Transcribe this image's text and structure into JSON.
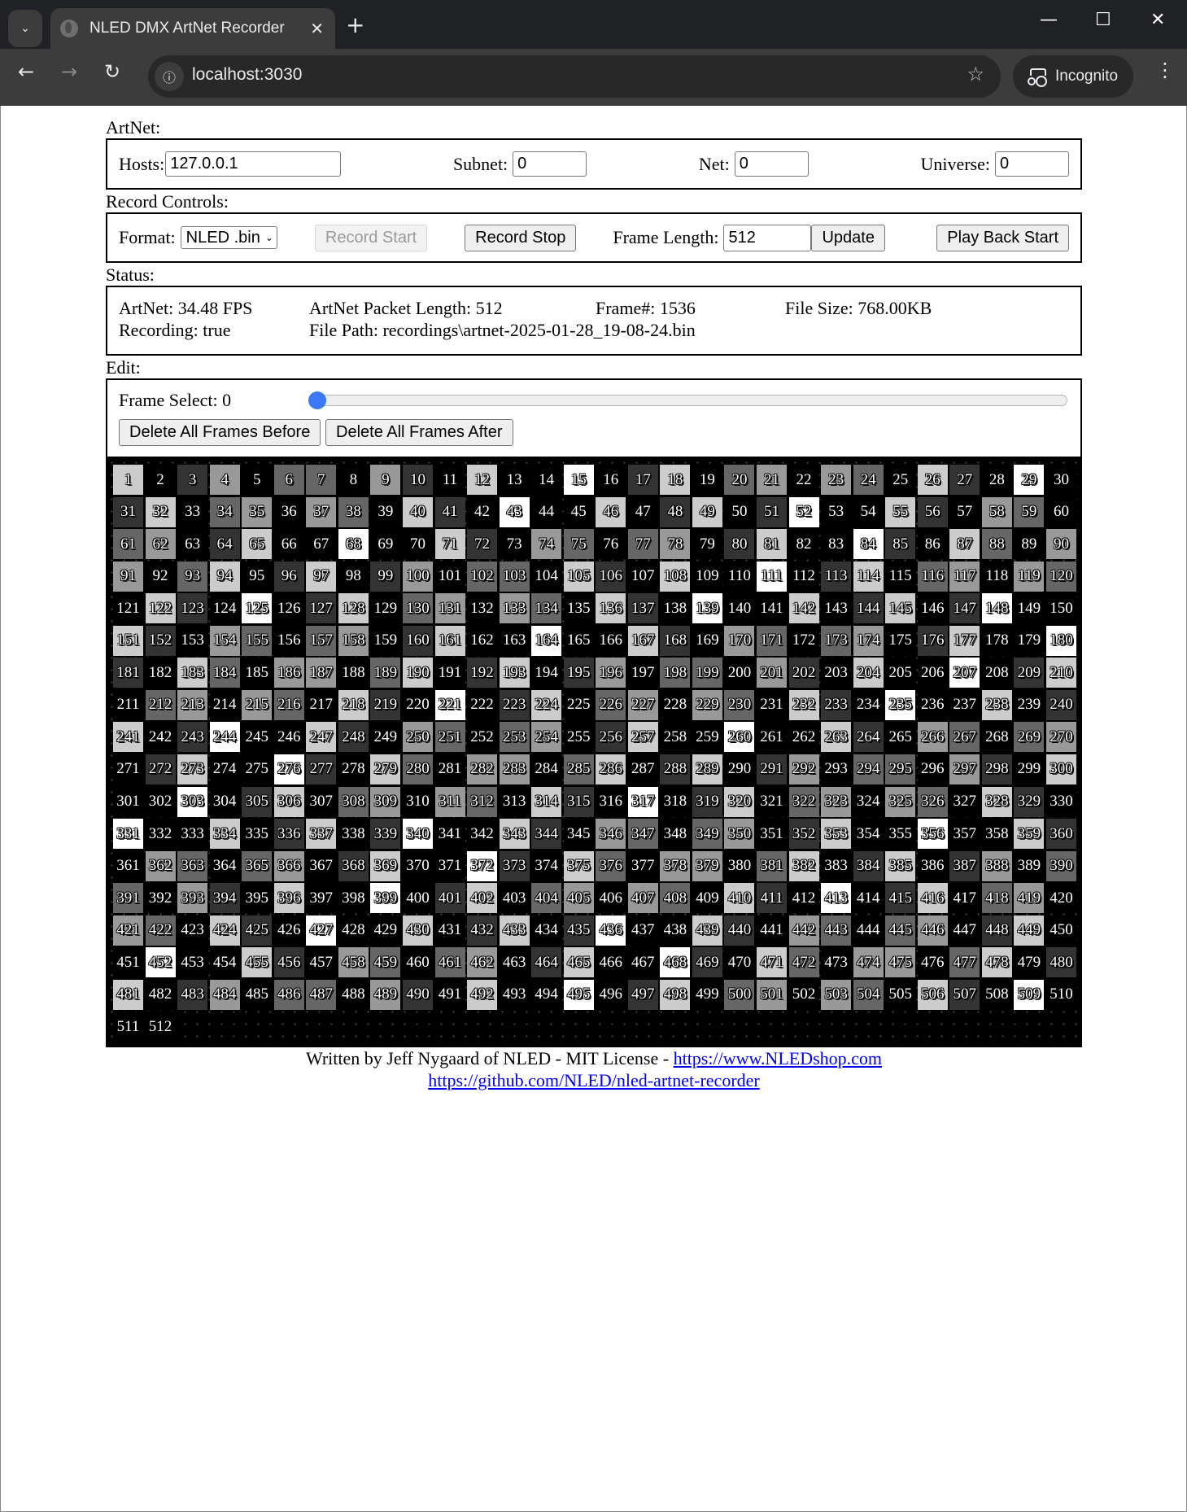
{
  "browser": {
    "tab_title": "NLED DMX ArtNet Recorder",
    "url": "localhost:3030",
    "incognito_label": "Incognito"
  },
  "artnet": {
    "section_label": "ArtNet:",
    "hosts_label": "Hosts:",
    "hosts_value": "127.0.0.1",
    "subnet_label": "Subnet:",
    "subnet_value": "0",
    "net_label": "Net:",
    "net_value": "0",
    "universe_label": "Universe:",
    "universe_value": "0"
  },
  "record": {
    "section_label": "Record Controls:",
    "format_label": "Format:",
    "format_value": "NLED .bin",
    "record_start_label": "Record Start",
    "record_stop_label": "Record Stop",
    "frame_length_label": "Frame Length:",
    "frame_length_value": "512",
    "update_label": "Update",
    "playback_label": "Play Back Start"
  },
  "status": {
    "section_label": "Status:",
    "fps": "ArtNet: 34.48 FPS",
    "packet_length": "ArtNet Packet Length: 512",
    "frame_number": "Frame#: 1536",
    "file_size": "File Size: 768.00KB",
    "recording": "Recording: true",
    "file_path": "File Path: recordings\\artnet-2025-01-28_19-08-24.bin"
  },
  "edit": {
    "section_label": "Edit:",
    "frame_select_label": "Frame Select: 0",
    "frame_select_value": 0,
    "delete_before_label": "Delete All Frames Before",
    "delete_after_label": "Delete All Frames After"
  },
  "channels": {
    "count": 512,
    "columns": 30,
    "gray_levels": [
      "#000000",
      "#333333",
      "#666666",
      "#999999",
      "#cccccc",
      "#ffffff"
    ],
    "levels": [
      4,
      0,
      1,
      3,
      0,
      2,
      2,
      0,
      3,
      1,
      0,
      4,
      0,
      0,
      5,
      0,
      1,
      4,
      0,
      2,
      3,
      0,
      3,
      2,
      0,
      4,
      1,
      0,
      5,
      0,
      1,
      4,
      0,
      2,
      3,
      0,
      3,
      2,
      0,
      4,
      1,
      0,
      5,
      0,
      0,
      4,
      0,
      1,
      4,
      0,
      1,
      5,
      0,
      0,
      4,
      1,
      0,
      3,
      2,
      0,
      2,
      3,
      0,
      1,
      4,
      0,
      0,
      5,
      0,
      0,
      4,
      1,
      0,
      3,
      2,
      0,
      2,
      3,
      0,
      1,
      4,
      0,
      0,
      5,
      1,
      0,
      4,
      2,
      0,
      3,
      3,
      0,
      2,
      4,
      0,
      1,
      4,
      0,
      1,
      3,
      0,
      2,
      2,
      0,
      4,
      1,
      0,
      4,
      0,
      0,
      5,
      0,
      1,
      4,
      0,
      2,
      3,
      0,
      3,
      2,
      0,
      4,
      1,
      0,
      5,
      0,
      1,
      4,
      0,
      2,
      3,
      0,
      3,
      2,
      0,
      4,
      1,
      0,
      5,
      0,
      0,
      4,
      0,
      1,
      4,
      0,
      1,
      5,
      0,
      0,
      4,
      1,
      0,
      3,
      2,
      0,
      2,
      3,
      0,
      1,
      4,
      0,
      0,
      5,
      0,
      0,
      4,
      1,
      0,
      3,
      2,
      0,
      2,
      3,
      0,
      1,
      4,
      0,
      0,
      5,
      1,
      0,
      4,
      2,
      0,
      3,
      3,
      0,
      2,
      4,
      0,
      1,
      4,
      0,
      1,
      3,
      0,
      2,
      2,
      0,
      3,
      1,
      0,
      4,
      0,
      0,
      5,
      0,
      1,
      4,
      0,
      2,
      3,
      0,
      3,
      2,
      0,
      4,
      1,
      0,
      5,
      0,
      1,
      4,
      0,
      2,
      3,
      0,
      3,
      2,
      0,
      4,
      1,
      0,
      5,
      0,
      0,
      4,
      0,
      1,
      4,
      0,
      1,
      5,
      0,
      0,
      4,
      1,
      0,
      3,
      2,
      0,
      2,
      3,
      0,
      1,
      4,
      0,
      0,
      5,
      0,
      0,
      4,
      1,
      0,
      3,
      2,
      0,
      2,
      3,
      0,
      1,
      4,
      0,
      0,
      5,
      1,
      0,
      4,
      2,
      0,
      3,
      3,
      0,
      2,
      4,
      0,
      1,
      4,
      0,
      1,
      3,
      0,
      2,
      2,
      0,
      3,
      1,
      0,
      4,
      0,
      0,
      5,
      0,
      1,
      4,
      0,
      2,
      3,
      0,
      3,
      2,
      0,
      4,
      1,
      0,
      5,
      0,
      1,
      4,
      0,
      2,
      3,
      0,
      3,
      2,
      0,
      4,
      1,
      0,
      5,
      0,
      0,
      4,
      0,
      1,
      4,
      0,
      1,
      5,
      0,
      0,
      4,
      1,
      0,
      3,
      2,
      0,
      2,
      3,
      0,
      1,
      4,
      0,
      0,
      5,
      0,
      0,
      4,
      1,
      0,
      3,
      2,
      0,
      2,
      3,
      0,
      1,
      4,
      0,
      0,
      5,
      1,
      0,
      4,
      2,
      0,
      3,
      3,
      0,
      2,
      4,
      0,
      1,
      4,
      0,
      1,
      3,
      0,
      2,
      2,
      0,
      3,
      1,
      0,
      4,
      0,
      0,
      5,
      0,
      1,
      4,
      0,
      2,
      3,
      0,
      3,
      2,
      0,
      4,
      1,
      0,
      5,
      0,
      1,
      4,
      0,
      2,
      3,
      0,
      3,
      2,
      0,
      4,
      1,
      0,
      5,
      0,
      0,
      4,
      0,
      1,
      4,
      0,
      1,
      5,
      0,
      0,
      4,
      1,
      0,
      3,
      2,
      0,
      2,
      3,
      0,
      1,
      4,
      0,
      0,
      5,
      0,
      0,
      4,
      1,
      0,
      3,
      2,
      0,
      2,
      3,
      0,
      1,
      4,
      0,
      0,
      5,
      1,
      0,
      4,
      2,
      0,
      3,
      3,
      0,
      2,
      4,
      0,
      1,
      4,
      0,
      1,
      3,
      0,
      2,
      2,
      0,
      3,
      1,
      0,
      4,
      0,
      0,
      5,
      0,
      1,
      4,
      0,
      2,
      3,
      0,
      3,
      2,
      0,
      4,
      1,
      0,
      5,
      0,
      0,
      0
    ]
  },
  "footer": {
    "credit": "Written by Jeff Nygaard of NLED - MIT License - ",
    "shop_link": "https://www.NLEDshop.com",
    "github_link": "https://github.com/NLED/nled-artnet-recorder"
  }
}
